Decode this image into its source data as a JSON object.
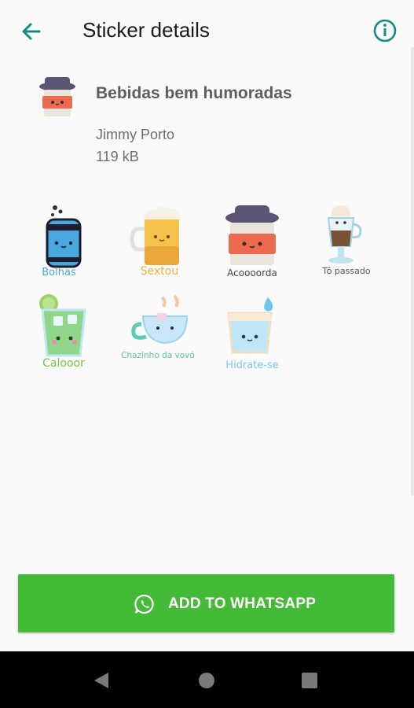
{
  "header": {
    "title": "Sticker details",
    "back_icon": "arrow-left-icon",
    "info_icon": "info-icon",
    "accent_color": "#128c7e"
  },
  "pack": {
    "name": "Bebidas bem humoradas",
    "author": "Jimmy Porto",
    "size": "119 kB"
  },
  "stickers": [
    {
      "label": "Bolhas",
      "color": "#4aa8e0"
    },
    {
      "label": "Sextou",
      "color": "#f0b13a"
    },
    {
      "label": "Acoooorda",
      "color": "#444444"
    },
    {
      "label": "Tô passado",
      "color": "#555555"
    },
    {
      "label": "Calooor",
      "color": "#7cc14d"
    },
    {
      "label": "Chazinho da vovó",
      "color": "#55c4b0"
    },
    {
      "label": "Hidrate-se",
      "color": "#7ec7ec"
    }
  ],
  "add_button": {
    "label": "ADD TO WHATSAPP",
    "icon": "whatsapp-icon",
    "color": "#44bb36"
  },
  "system_nav": {
    "back": "nav-back-icon",
    "home": "nav-home-icon",
    "recents": "nav-recents-icon"
  }
}
